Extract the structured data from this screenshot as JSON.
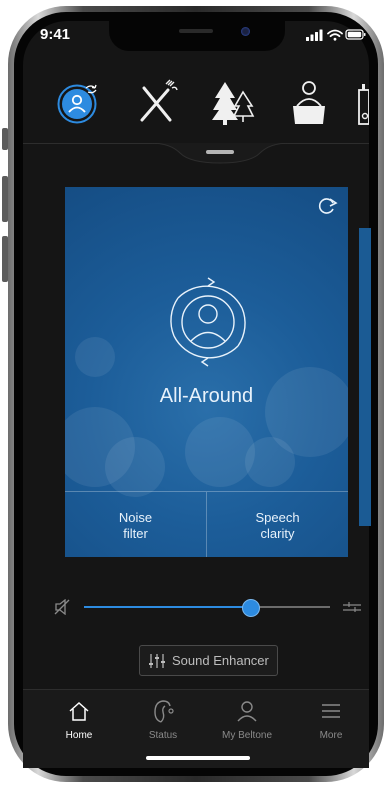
{
  "status_bar": {
    "time": "9:41"
  },
  "program": {
    "title": "All-Around"
  },
  "controls": {
    "noise_filter": "Noise\nfilter",
    "speech_clarity": "Speech\nclarity"
  },
  "volume": {
    "level": 0.68
  },
  "sound_enhancer": {
    "label": "Sound Enhancer"
  },
  "tabs": [
    {
      "label": "Home",
      "icon": "home-icon",
      "active": true
    },
    {
      "label": "Status",
      "icon": "hearing-aid-icon",
      "active": false
    },
    {
      "label": "My Beltone",
      "icon": "person-icon",
      "active": false
    },
    {
      "label": "More",
      "icon": "menu-icon",
      "active": false
    }
  ],
  "colors": {
    "accent": "#2d8be0",
    "card": "#1c5d99",
    "background": "#151515"
  }
}
